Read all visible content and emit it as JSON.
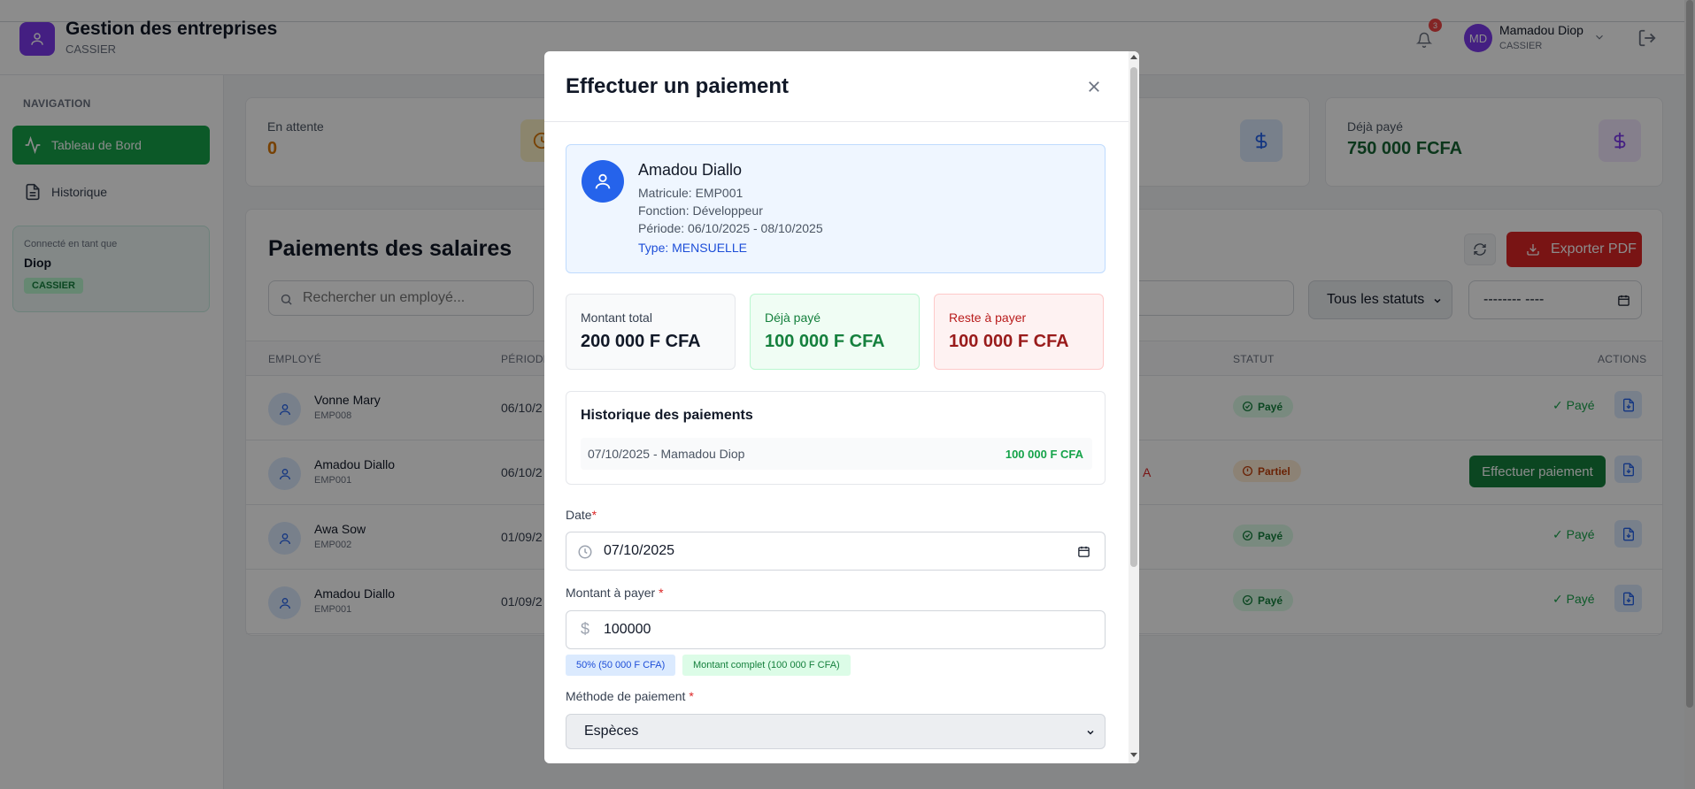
{
  "header": {
    "app_title": "Gestion des entreprises",
    "app_subtitle": "CASSIER",
    "notification_count": "3",
    "user_initials": "MD",
    "user_name": "Mamadou Diop",
    "user_role": "CASSIER"
  },
  "sidebar": {
    "nav_label": "NAVIGATION",
    "items": [
      {
        "label": "Tableau de Bord",
        "active": true
      },
      {
        "label": "Historique",
        "active": false
      }
    ],
    "connected_label": "Connecté en tant que",
    "connected_name": "Diop",
    "connected_role": "CASSIER"
  },
  "stats": [
    {
      "label": "En attente",
      "value": "0",
      "color": "#d97706"
    },
    {
      "label": "Déjà payé",
      "value": "750 000 FCFA",
      "color": "#166534"
    }
  ],
  "main": {
    "title": "Paiements des salaires",
    "export_label": "Exporter PDF",
    "search_placeholder": "Rechercher un employé...",
    "status_filter": "Tous les statuts",
    "date_filter": "-------- ----",
    "columns": {
      "employee": "EMPLOYÉ",
      "period": "PÉRIODE",
      "status": "STATUT",
      "actions": "ACTIONS"
    },
    "rows": [
      {
        "name": "Vonne Mary",
        "code": "EMP008",
        "period": "06/10/2",
        "overflow": "",
        "status": "Payé",
        "action": "✓ Payé"
      },
      {
        "name": "Amadou Diallo",
        "code": "EMP001",
        "period": "06/10/2",
        "overflow": "A",
        "status": "Partiel",
        "action": "Effectuer paiement"
      },
      {
        "name": "Awa Sow",
        "code": "EMP002",
        "period": "01/09/2",
        "overflow": "",
        "status": "Payé",
        "action": "✓ Payé"
      },
      {
        "name": "Amadou Diallo",
        "code": "EMP001",
        "period": "01/09/2",
        "overflow": "",
        "status": "Payé",
        "action": "✓ Payé"
      }
    ]
  },
  "modal": {
    "title": "Effectuer un paiement",
    "employee": {
      "name": "Amadou Diallo",
      "matricule": "Matricule: EMP001",
      "fonction": "Fonction: Développeur",
      "periode": "Période: 06/10/2025 - 08/10/2025",
      "type": "Type: MENSUELLE"
    },
    "amounts": {
      "total_label": "Montant total",
      "total_value": "200 000 F CFA",
      "paid_label": "Déjà payé",
      "paid_value": "100 000 F CFA",
      "rest_label": "Reste à payer",
      "rest_value": "100 000 F CFA"
    },
    "history": {
      "title": "Historique des paiements",
      "entries": [
        {
          "left": "07/10/2025 - Mamadou Diop",
          "right": "100 000 F CFA"
        }
      ]
    },
    "form": {
      "date_label": "Date",
      "date_value": "07/10/2025",
      "amount_label": "Montant à payer ",
      "amount_value": "100000",
      "quick_half": "50% (50 000 F CFA)",
      "quick_full": "Montant complet (100 000 F CFA)",
      "method_label": "Méthode de paiement ",
      "method_value": "Espèces",
      "required_mark": "*"
    }
  },
  "colors": {
    "accent_green": "#16a34a",
    "danger_red": "#dc2626",
    "brand_purple": "#7c3aed",
    "info_blue": "#2563eb"
  }
}
